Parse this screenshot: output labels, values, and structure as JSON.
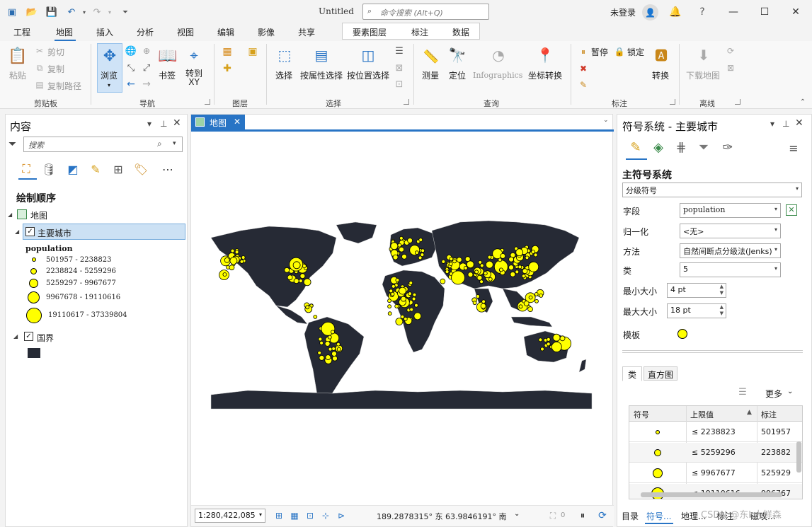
{
  "titlebar": {
    "doc_title": "Untitled",
    "search_placeholder": "命令搜索 (Alt+Q)",
    "user_status": "未登录"
  },
  "ribbon_tabs": [
    "工程",
    "地图",
    "插入",
    "分析",
    "视图",
    "编辑",
    "影像",
    "共享"
  ],
  "active_tab": "地图",
  "context_tabs": [
    "要素图层",
    "标注",
    "数据"
  ],
  "ribbon": {
    "clipboard": {
      "label": "剪贴板",
      "paste": "粘贴",
      "cut": "剪切",
      "copy": "复制",
      "copy_path": "复制路径"
    },
    "navigate": {
      "label": "导航",
      "explore": "浏览",
      "bookmarks": "书签",
      "goto_xy": "转到\nXY"
    },
    "layer": {
      "label": "图层"
    },
    "selection": {
      "label": "选择",
      "select": "选择",
      "select_by_attr": "按属性选择",
      "select_by_loc": "按位置选择"
    },
    "inquiry": {
      "label": "查询",
      "measure": "测量",
      "locate": "定位",
      "infographics": "Infographics",
      "coord_convert": "坐标转换"
    },
    "labeling": {
      "label": "标注",
      "pause": "暂停",
      "lock": "锁定",
      "convert": "转换"
    },
    "offline": {
      "label": "离线",
      "download_map": "下载地图"
    }
  },
  "contents": {
    "title": "内容",
    "search_placeholder": "搜索",
    "drawing_order": "绘制顺序",
    "map_name": "地图",
    "layer1": "主要城市",
    "field": "population",
    "classes": [
      "501957 - 2238823",
      "2238824 - 5259296",
      "5259297 - 9967677",
      "9967678 - 19110616",
      "19110617 - 37339804"
    ],
    "layer2": "国界"
  },
  "map_view": {
    "tab": "地图",
    "scale": "1:280,422,085",
    "coordinates": "189.2878315° 东  63.9846191° 南",
    "selected_count": "0"
  },
  "symbology": {
    "title": "符号系统 - 主要城市",
    "primary": "主符号系统",
    "method_type": "分级符号",
    "field_label": "字段",
    "field_value": "population",
    "normalize_label": "归一化",
    "normalize_value": "<无>",
    "method_label": "方法",
    "method_value": "自然间断点分级法(Jenks)",
    "classes_label": "类",
    "classes_value": "5",
    "min_size_label": "最小大小",
    "min_size_value": "4 pt",
    "max_size_label": "最大大小",
    "max_size_value": "18 pt",
    "template_label": "模板",
    "tab_classes": "类",
    "tab_histogram": "直方图",
    "more": "更多",
    "columns": [
      "符号",
      "上限值",
      "标注"
    ],
    "rows": [
      {
        "upper": "≤   2238823",
        "label": "501957"
      },
      {
        "upper": "≤   5259296",
        "label": "223882"
      },
      {
        "upper": "≤   9967677",
        "label": "525929"
      },
      {
        "upper": "≤   19110616",
        "label": "996767"
      }
    ]
  },
  "bottom_tabs": [
    "目录",
    "符号...",
    "地理...",
    "标注",
    "磁攻..."
  ],
  "watermark": "CSDN @东k大鲜森",
  "colors": {
    "accent": "#2874c5",
    "symbol_fill": "#ffff00",
    "land": "#262a35"
  }
}
